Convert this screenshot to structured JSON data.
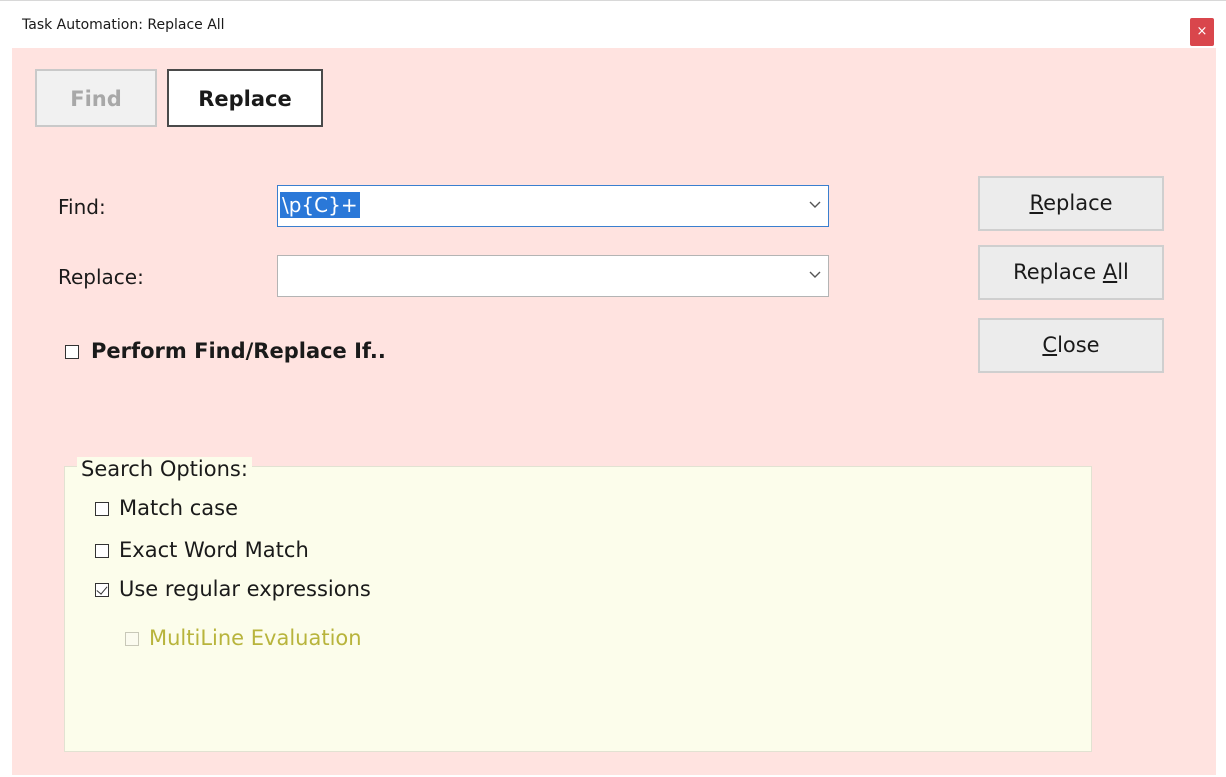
{
  "window": {
    "title": "Task Automation: Replace All",
    "close_symbol": "×"
  },
  "tabs": {
    "find": "Find",
    "replace": "Replace"
  },
  "find_label": "Find:",
  "find_value": "\\p{C}+",
  "replace_label": "Replace:",
  "replace_value": "",
  "perform_if_label": "Perform Find/Replace If..",
  "buttons": {
    "replace": {
      "mnemonic": "R",
      "rest": "eplace"
    },
    "replace_all": {
      "prefix": "Replace ",
      "mnemonic": "A",
      "rest": "ll"
    },
    "close": {
      "mnemonic": "C",
      "rest": "lose"
    }
  },
  "search_options": {
    "legend": "Search Options:",
    "match_case": {
      "label": "Match case",
      "checked": false
    },
    "exact_word": {
      "label": "Exact Word Match",
      "checked": false
    },
    "regex": {
      "label": "Use regular expressions",
      "checked": true
    },
    "multiline": {
      "label": "MultiLine Evaluation",
      "checked": false,
      "enabled": false
    }
  },
  "colors": {
    "panel_bg": "#ffe3e0",
    "options_bg": "#fcfdeb",
    "selection": "#2a78d8",
    "close_bg": "#d9464c",
    "disabled_text": "#b8b43c"
  }
}
